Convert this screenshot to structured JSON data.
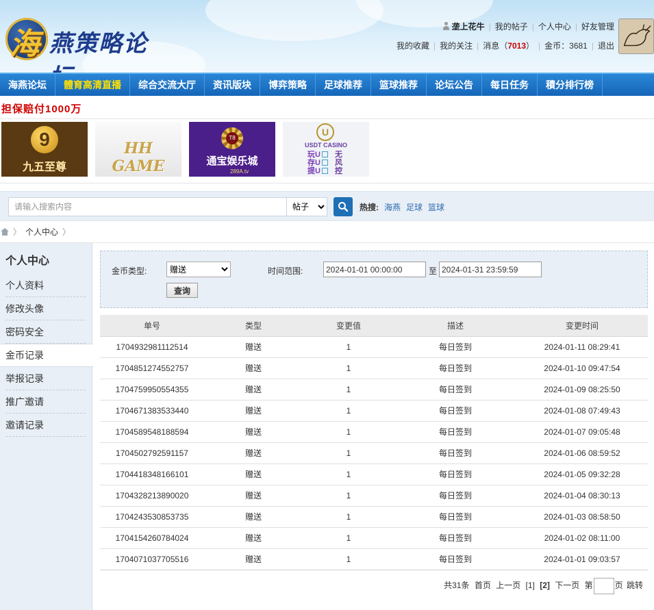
{
  "site": {
    "logo_char": "海",
    "logo_text": "燕策略论坛"
  },
  "user": {
    "name": "垄上花牛",
    "links_row1": [
      "我的帖子",
      "个人中心",
      "好友管理"
    ],
    "links_row2": [
      "我的收藏",
      "我的关注"
    ],
    "message_label": "消息",
    "message_count": "7013",
    "coins_label": "金币：3681",
    "logout_label": "退出"
  },
  "nav": {
    "items": [
      "海燕论坛",
      "體育高清直播",
      "综合交流大厅",
      "资讯版块",
      "博弈策略",
      "足球推荐",
      "篮球推荐",
      "论坛公告",
      "每日任务",
      "積分排行榜"
    ],
    "highlight_index": 1
  },
  "promo": "担保赔付1000万",
  "banners": {
    "b1_mark": "9",
    "b1_text": "九五至尊",
    "b2_text": "HH GAME",
    "b3_text": "通宝娱乐城",
    "b3_sub": "289A.tv",
    "b4_mark": "U",
    "b4_title": "USDT CASINO",
    "b4_lines": [
      "玩U",
      "存U",
      "提U"
    ],
    "b4_right": [
      "无",
      "风",
      "控"
    ]
  },
  "search": {
    "placeholder": "请输入搜索内容",
    "select_value": "帖子",
    "hot_label": "热搜:",
    "hot_links": [
      "海燕",
      "足球",
      "篮球"
    ]
  },
  "breadcrumb": {
    "current": "个人中心"
  },
  "sidebar": {
    "title": "个人中心",
    "items": [
      "个人资料",
      "修改头像",
      "密码安全",
      "金币记录",
      "举报记录",
      "推广邀请",
      "邀请记录"
    ],
    "active_index": 3
  },
  "filter": {
    "coin_type_label": "金币类型:",
    "coin_type_value": "赠送",
    "time_range_label": "时间范围:",
    "start": "2024-01-01 00:00:00",
    "to_label": "至",
    "end": "2024-01-31 23:59:59",
    "query_label": "查询"
  },
  "table": {
    "headers": [
      "单号",
      "类型",
      "变更值",
      "描述",
      "变更时间"
    ],
    "rows": [
      [
        "1704932981112514",
        "赠送",
        "1",
        "每日签到",
        "2024-01-11 08:29:41"
      ],
      [
        "1704851274552757",
        "赠送",
        "1",
        "每日签到",
        "2024-01-10 09:47:54"
      ],
      [
        "1704759950554355",
        "赠送",
        "1",
        "每日签到",
        "2024-01-09 08:25:50"
      ],
      [
        "1704671383533440",
        "赠送",
        "1",
        "每日签到",
        "2024-01-08 07:49:43"
      ],
      [
        "1704589548188594",
        "赠送",
        "1",
        "每日签到",
        "2024-01-07 09:05:48"
      ],
      [
        "1704502792591157",
        "赠送",
        "1",
        "每日签到",
        "2024-01-06 08:59:52"
      ],
      [
        "1704418348166101",
        "赠送",
        "1",
        "每日签到",
        "2024-01-05 09:32:28"
      ],
      [
        "1704328213890020",
        "赠送",
        "1",
        "每日签到",
        "2024-01-04 08:30:13"
      ],
      [
        "1704243530853735",
        "赠送",
        "1",
        "每日签到",
        "2024-01-03 08:58:50"
      ],
      [
        "1704154260784024",
        "赠送",
        "1",
        "每日签到",
        "2024-01-02 08:11:00"
      ],
      [
        "1704071037705516",
        "赠送",
        "1",
        "每日签到",
        "2024-01-01 09:03:57"
      ]
    ]
  },
  "pagination": {
    "total": "共31条",
    "first": "首页",
    "prev": "上一页",
    "page1": "[1]",
    "page2": "[2]",
    "next": "下一页",
    "jump_prefix": "第",
    "jump_suffix": "页",
    "jump_label": "跳转"
  }
}
